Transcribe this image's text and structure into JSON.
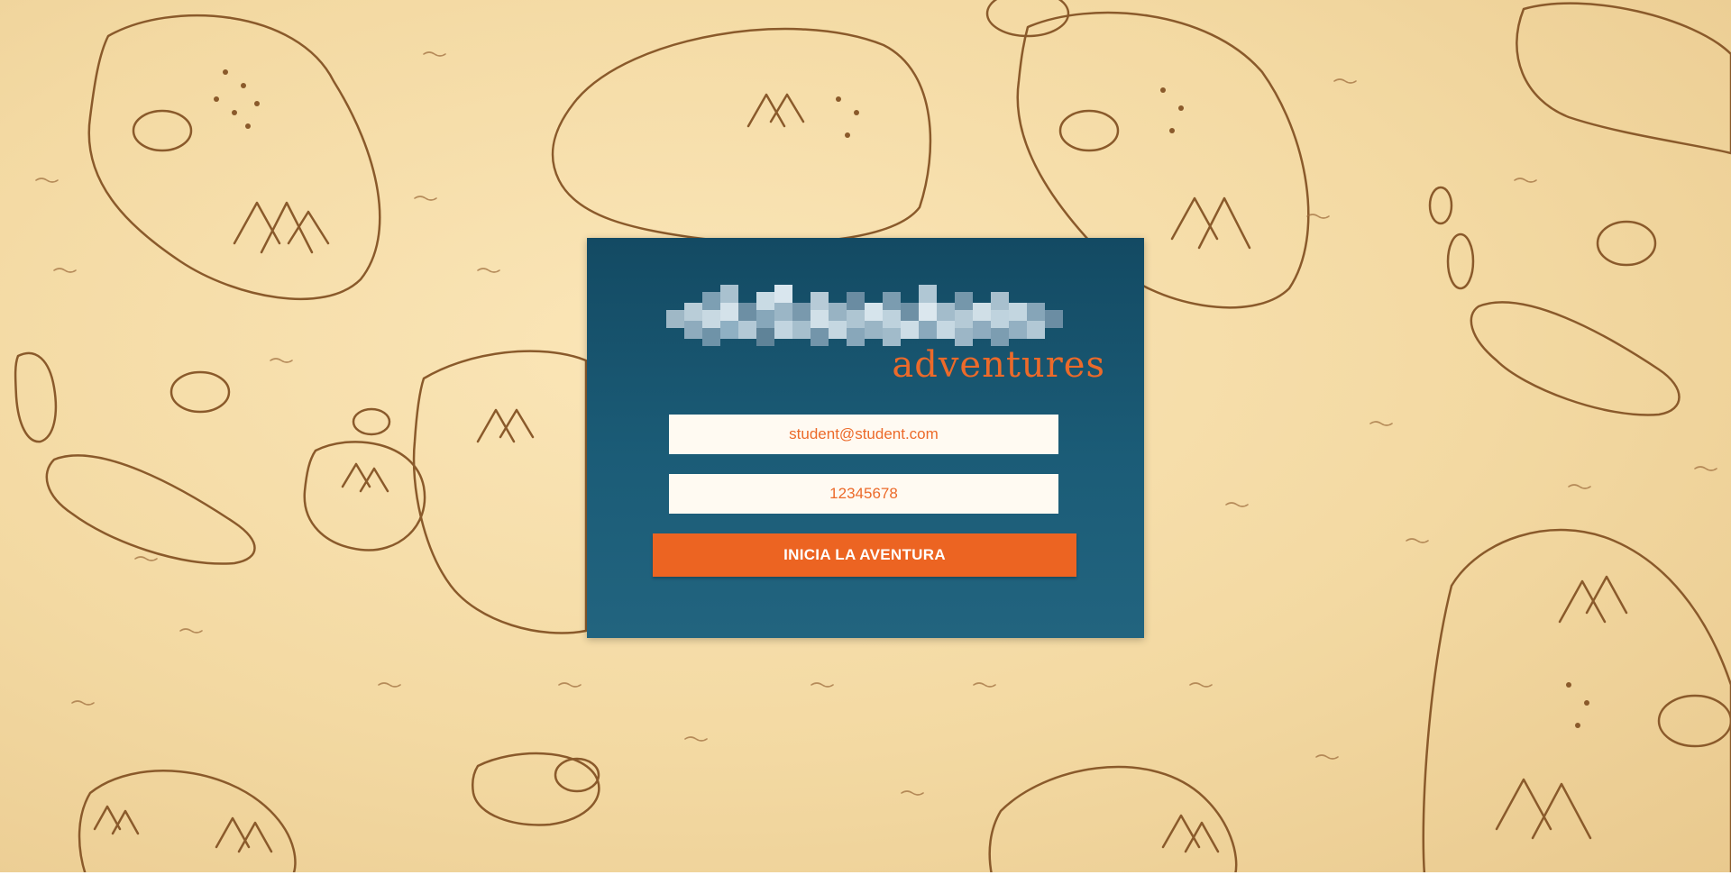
{
  "colors": {
    "parchment": "#f3d9a2",
    "ink": "#8a5a2b",
    "card_top": "#134a63",
    "card_bottom": "#22647f",
    "accent": "#ec6422",
    "field_bg": "#fffaf2"
  },
  "brand": {
    "logo_icon": "blurred-logo-image",
    "subtitle": "adventures"
  },
  "login": {
    "email_value": "student@student.com",
    "password_value": "12345678",
    "submit_label": "INICIA LA AVENTURA"
  }
}
